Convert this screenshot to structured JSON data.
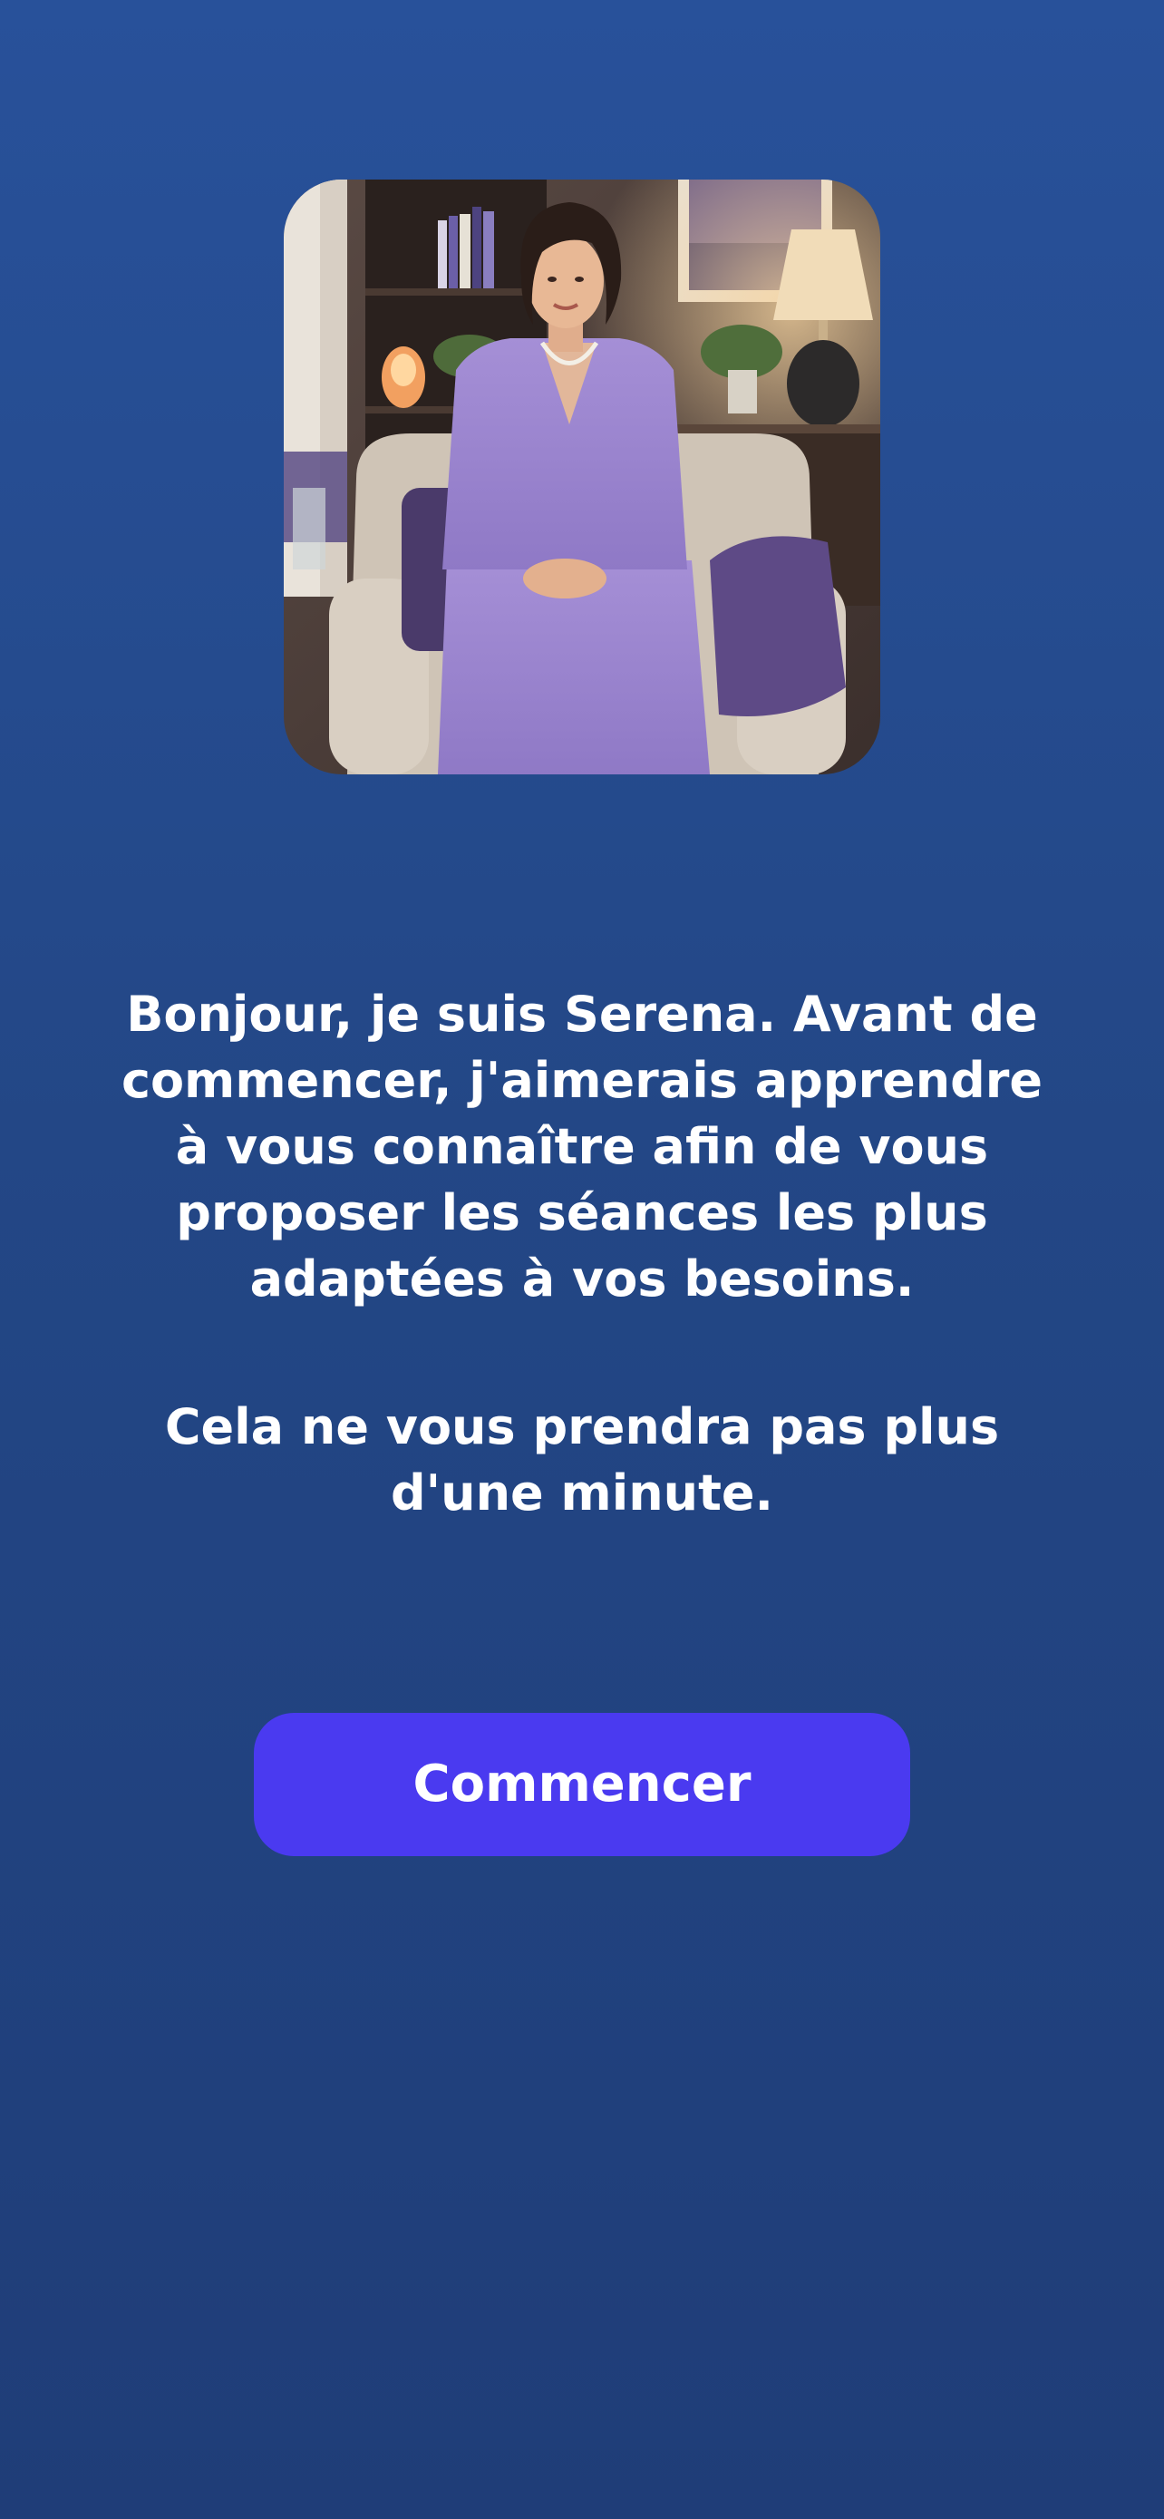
{
  "status_bar": {
    "time": "",
    "indicators": ""
  },
  "onboarding": {
    "portrait_icon": "serena-portrait",
    "intro_text": "Bonjour, je suis Serena. Avant de commencer, j'aimerais apprendre à vous connaître afin de vous proposer les séances les plus adaptées à vos besoins.",
    "duration_text": "Cela ne vous prendra pas plus d'une minute.",
    "start_button_label": "Commencer"
  },
  "colors": {
    "background_top": "#28519a",
    "background_bottom": "#1f3d78",
    "button": "#4a3af0",
    "text": "#ffffff"
  }
}
